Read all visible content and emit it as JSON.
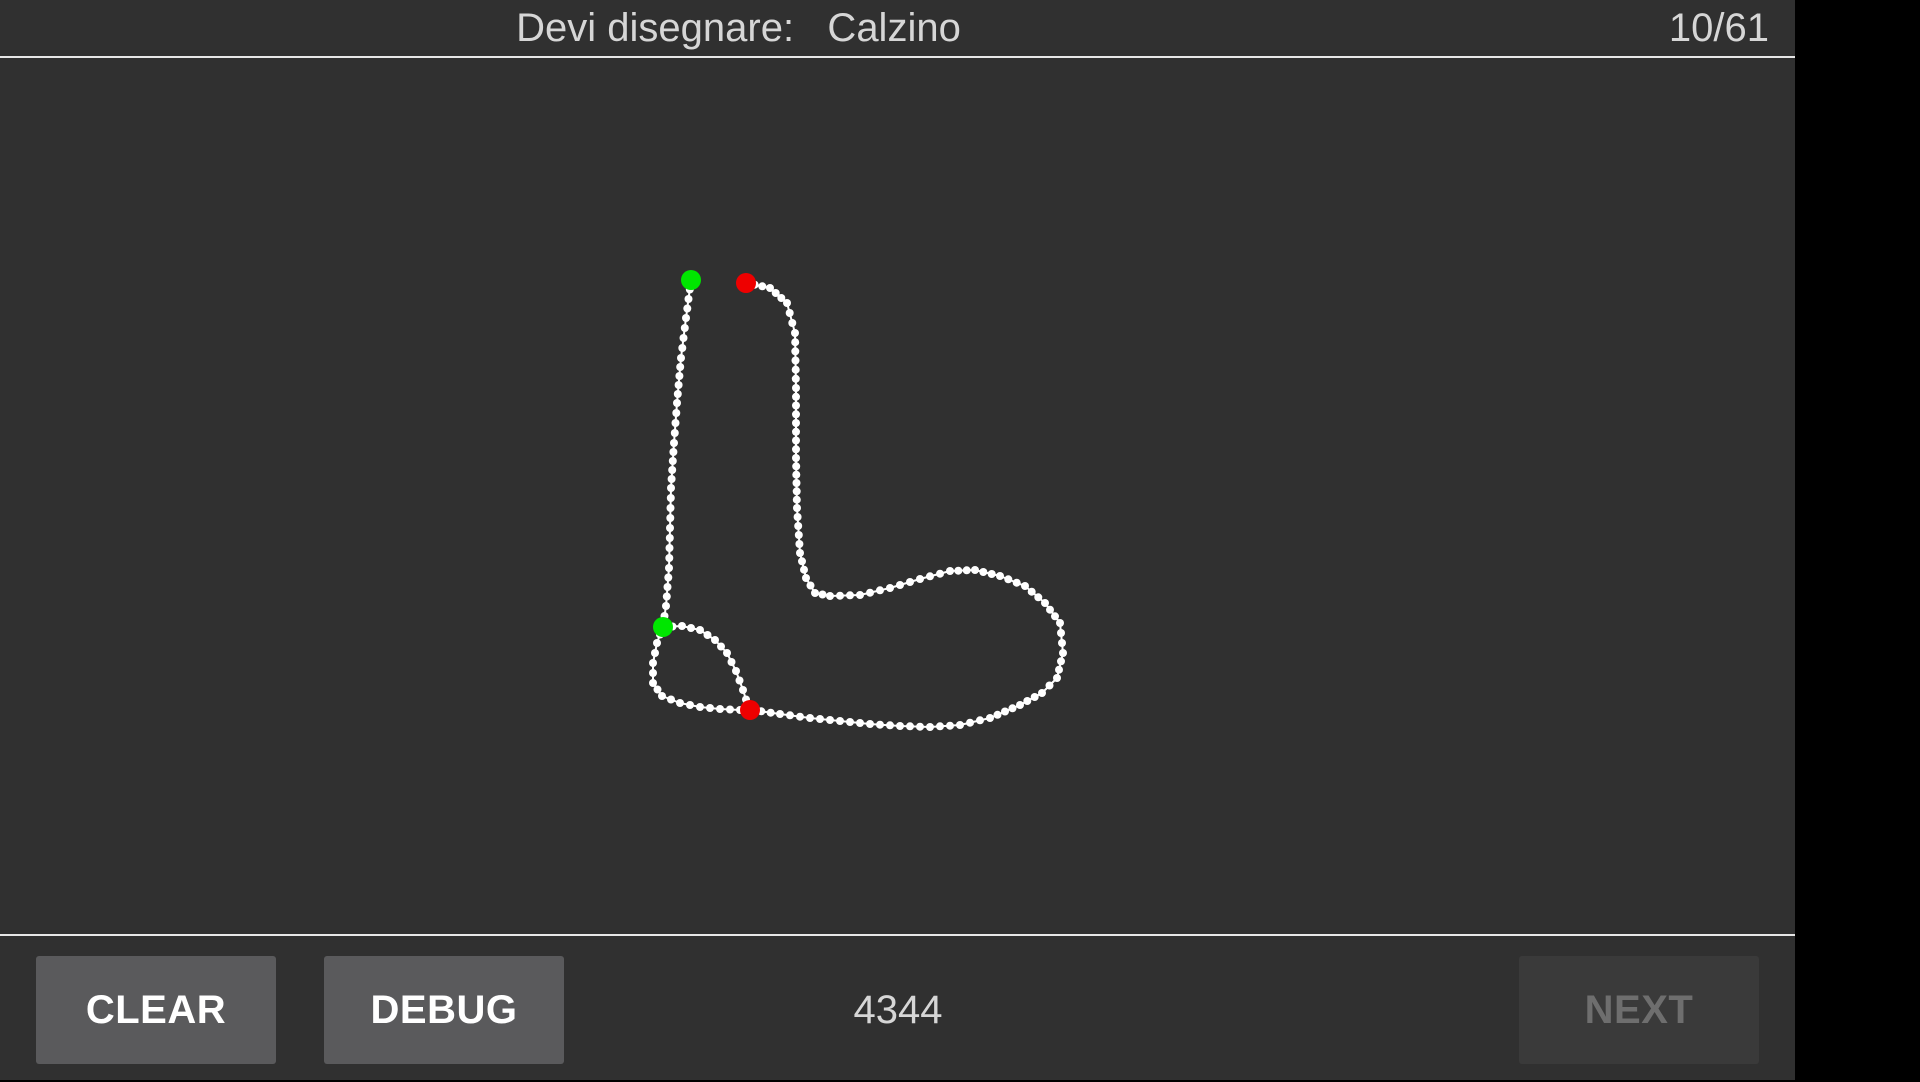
{
  "header": {
    "prompt": "Devi disegnare:   Calzino",
    "progress": "10/61"
  },
  "toolbar": {
    "clear_label": "CLEAR",
    "debug_label": "DEBUG",
    "score": "4344",
    "next_label": "NEXT"
  },
  "colors": {
    "background": "#303030",
    "ink": "#ffffff",
    "stroke_start": "#00e600",
    "stroke_end": "#ee0000",
    "button": "#5a5a5c",
    "button_disabled": "#3a3a3a"
  }
}
